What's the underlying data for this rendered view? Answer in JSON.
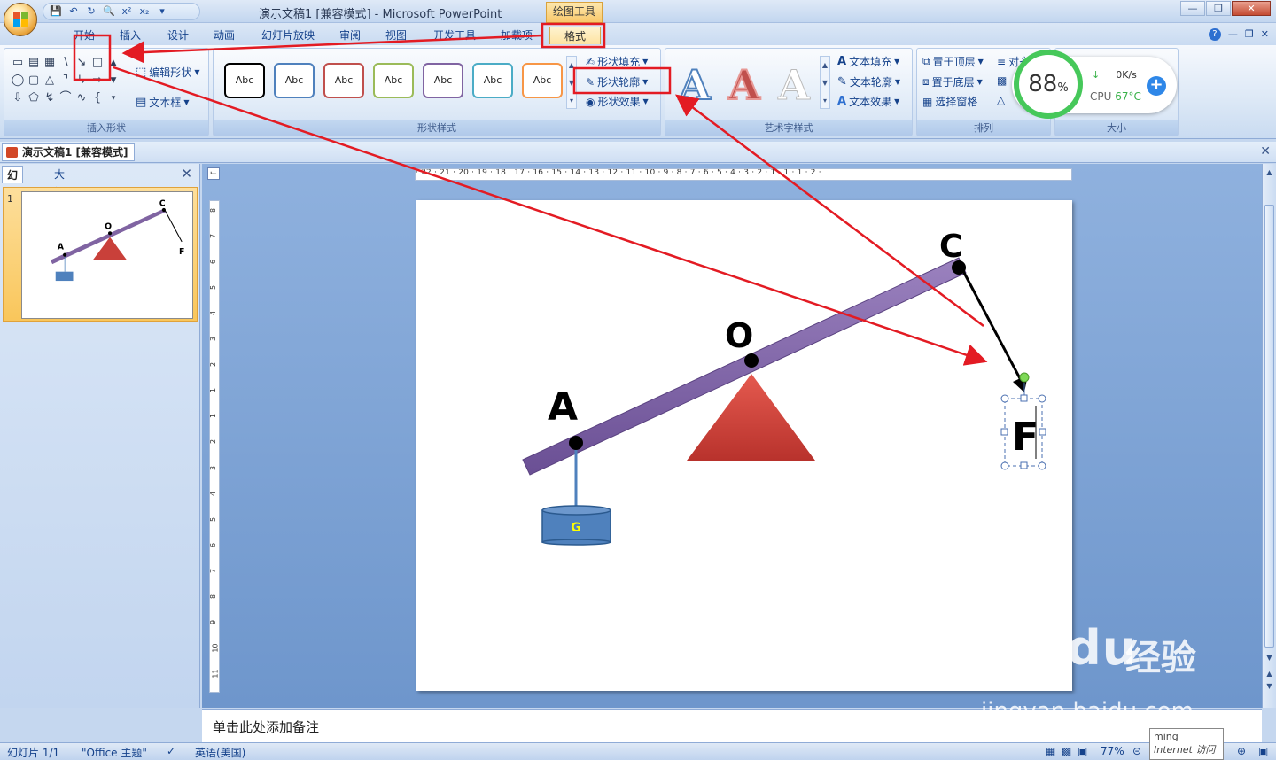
{
  "titlebar": {
    "title": "演示文稿1 [兼容模式] - Microsoft PowerPoint",
    "context_tool": "绘图工具",
    "qat": [
      "save-icon",
      "undo-icon",
      "redo-icon",
      "preview-icon",
      "superscript-icon",
      "subscript-icon"
    ],
    "qat_labels": [
      "x²",
      "x₂"
    ]
  },
  "tabs": [
    "开始",
    "插入",
    "设计",
    "动画",
    "幻灯片放映",
    "审阅",
    "视图",
    "开发工具",
    "加载项",
    "格式"
  ],
  "ribbon": {
    "insert_shapes": {
      "label": "插入形状",
      "edit_shape": "编辑形状",
      "text_box": "文本框"
    },
    "shape_styles": {
      "label": "形状样式",
      "sample": "Abc",
      "fill": "形状填充",
      "outline": "形状轮廓",
      "effects": "形状效果",
      "swatch_colors": [
        "#000000",
        "#4f81bd",
        "#c0504d",
        "#9bbb59",
        "#8064a2",
        "#4bacc6",
        "#f79646"
      ]
    },
    "wordart": {
      "label": "艺术字样式",
      "glyph": "A",
      "text_fill": "文本填充",
      "text_outline": "文本轮廓",
      "text_effects": "文本效果"
    },
    "arrange": {
      "label": "排列",
      "bring_front": "置于顶层",
      "send_back": "置于底层",
      "selection_pane": "选择窗格",
      "align": "对齐"
    },
    "size": {
      "label": "大小"
    }
  },
  "cpu_widget": {
    "percent": "88",
    "percent_sign": "%",
    "speed": "0K/s",
    "cpu_label": "CPU",
    "temp": "67°C"
  },
  "doc_tab": "演示文稿1 [兼容模式]",
  "left_panel": {
    "tabs": [
      "幻灯片",
      "大纲"
    ],
    "slide_number": "1"
  },
  "ruler": {
    "horizontal": "· 22 · 21 · 20 · 19 · 18 · 17 · 16 · 15 · 14 · 13 · 12 · 11 · 10 · 9 · 8 · 7 · 6 · 5 · 4 · 3 · 2 · 1 · 1 · 1 · 2 ·",
    "vertical_numbers": [
      "8",
      "7",
      "6",
      "5",
      "4",
      "3",
      "2",
      "1",
      "1",
      "2",
      "3",
      "4",
      "5",
      "6",
      "7",
      "8",
      "9",
      "10",
      "11"
    ]
  },
  "slide": {
    "labels": {
      "A": "A",
      "O": "O",
      "C": "C",
      "F": "F",
      "G": "G"
    },
    "colors": {
      "lever": "#8064a2",
      "triangle": "#d2403a",
      "weight": "#4f81bd",
      "weight_text": "#ffff00",
      "annotation": "#e31b23"
    }
  },
  "notes": {
    "placeholder": "单击此处添加备注"
  },
  "statusbar": {
    "slide": "幻灯片 1/1",
    "theme": "\"Office 主题\"",
    "language": "英语(美国)",
    "zoom": "77%"
  },
  "popup": {
    "line1": "ming",
    "line2": "Internet 访问"
  },
  "watermark": {
    "brand": "Baidu",
    "cn": "经验",
    "url": "jingyan.baidu.com"
  }
}
